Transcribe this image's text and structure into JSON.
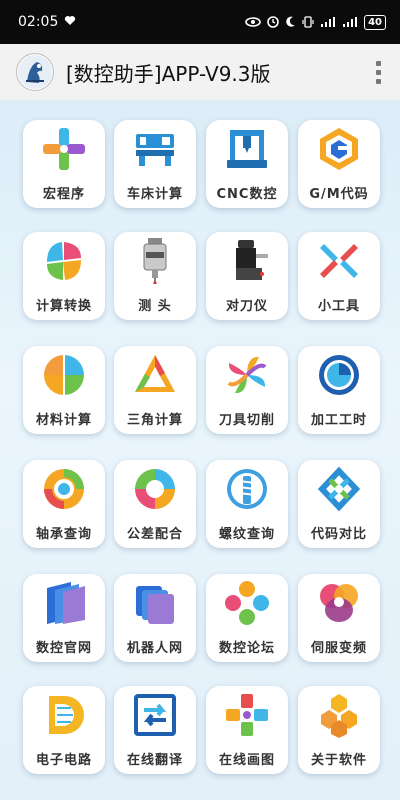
{
  "status_bar": {
    "time": "02:05",
    "battery": "40"
  },
  "app_bar": {
    "title": "[数控助手]APP-V9.3版"
  },
  "grid": {
    "items": [
      {
        "label": "宏程序",
        "icon": "macro-program-icon"
      },
      {
        "label": "车床计算",
        "icon": "lathe-icon"
      },
      {
        "label": "CNC数控",
        "icon": "cnc-machine-icon"
      },
      {
        "label": "G/M代码",
        "icon": "gm-code-icon"
      },
      {
        "label": "计算转换",
        "icon": "conversion-icon"
      },
      {
        "label": "测  头",
        "icon": "probe-icon"
      },
      {
        "label": "对刀仪",
        "icon": "tool-setter-icon"
      },
      {
        "label": "小工具",
        "icon": "tools-icon"
      },
      {
        "label": "材料计算",
        "icon": "material-icon"
      },
      {
        "label": "三角计算",
        "icon": "triangle-icon"
      },
      {
        "label": "刀具切削",
        "icon": "cutting-tool-icon"
      },
      {
        "label": "加工工时",
        "icon": "machining-time-icon"
      },
      {
        "label": "轴承查询",
        "icon": "bearing-icon"
      },
      {
        "label": "公差配合",
        "icon": "tolerance-icon"
      },
      {
        "label": "螺纹查询",
        "icon": "thread-icon"
      },
      {
        "label": "代码对比",
        "icon": "code-compare-icon"
      },
      {
        "label": "数控官网",
        "icon": "official-site-icon"
      },
      {
        "label": "机器人网",
        "icon": "robot-network-icon"
      },
      {
        "label": "数控论坛",
        "icon": "forum-icon"
      },
      {
        "label": "伺服变频",
        "icon": "servo-icon"
      },
      {
        "label": "电子电路",
        "icon": "circuit-icon"
      },
      {
        "label": "在线翻译",
        "icon": "translate-icon"
      },
      {
        "label": "在线画图",
        "icon": "drawing-icon"
      },
      {
        "label": "关于软件",
        "icon": "about-icon"
      }
    ]
  }
}
